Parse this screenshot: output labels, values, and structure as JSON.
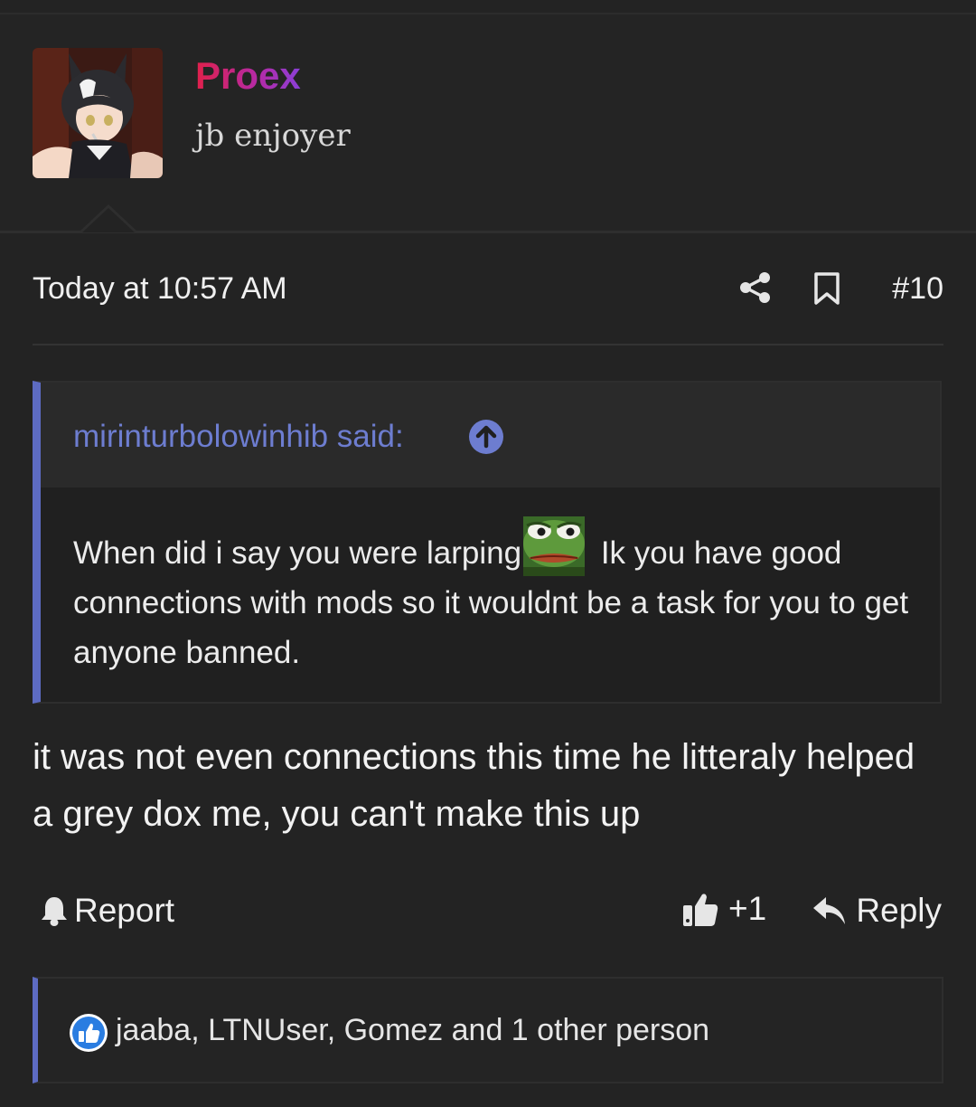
{
  "post": {
    "author": "Proex",
    "author_title": "jb enjoyer",
    "timestamp": "Today at 10:57 AM",
    "number": "#10",
    "quote": {
      "author_label": "mirinturbolowinhib said:",
      "text_before_emoji": "When did i say you were larping",
      "text_after_emoji": " Ik you have good connections with mods so it wouldnt be a task for you to get anyone banned.",
      "emoji": "pepe-emoji"
    },
    "body": "it was not even connections this time he litteraly helped a grey dox me, you can't make this up"
  },
  "actions": {
    "report_label": "Report",
    "like_label": "+1",
    "reply_label": "Reply"
  },
  "reactions": {
    "text": "jaaba, LTNUser, Gomez and 1 other person"
  },
  "colors": {
    "background": "#232323",
    "accent": "#5d6bc2",
    "quote_author": "#6d7dd0",
    "username_gradient_start": "#e0204a",
    "username_gradient_end": "#8a40d8",
    "reaction_badge": "#2a7de1"
  }
}
